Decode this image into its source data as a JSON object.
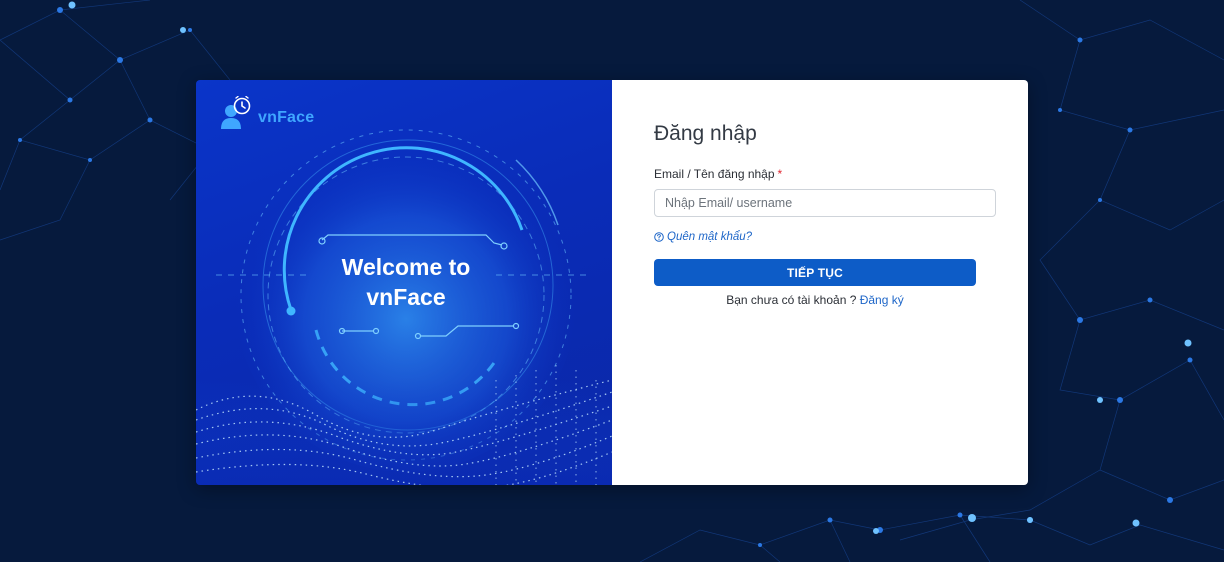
{
  "brand": {
    "name": "vnFace"
  },
  "welcome": {
    "line1": "Welcome to",
    "line2": "vnFace"
  },
  "login": {
    "title": "Đăng nhập",
    "email_label": "Email / Tên đăng nhập",
    "required_mark": "*",
    "email_placeholder": "Nhập Email/ username",
    "email_value": "",
    "forgot_label": "Quên mật khẩu?",
    "submit_label": "TIẾP TỤC",
    "no_account_text": "Bạn chưa có tài khoản ?",
    "signup_label": "Đăng ký"
  },
  "colors": {
    "page_background": "#061a3d",
    "panel_blue": "#0a35c9",
    "accent_cyan": "#3fa6ff",
    "button_blue": "#0d5cc7",
    "link_blue": "#1e66c8",
    "required_red": "#e0242f"
  },
  "icons": [
    "user-clock-icon",
    "question-circle-icon"
  ]
}
